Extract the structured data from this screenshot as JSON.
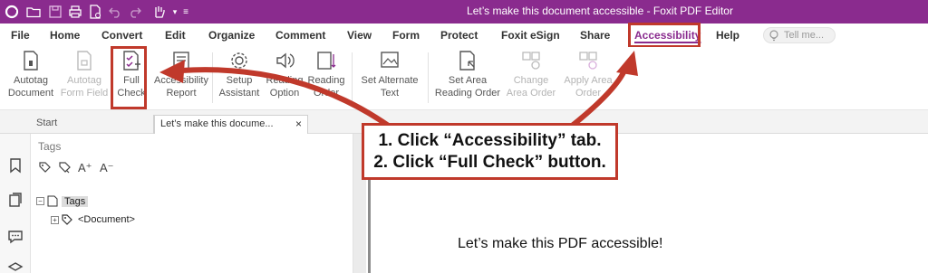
{
  "app": {
    "title": "Let’s make this document accessible - Foxit PDF Editor",
    "brand_color": "#8a2b8e",
    "callout_color": "#c0392b"
  },
  "quick_access": [
    "foxit-logo-icon",
    "open-icon",
    "save-icon",
    "print-icon",
    "new-doc-icon",
    "undo-icon",
    "redo-icon",
    "hand-tool-icon",
    "customize-icon"
  ],
  "menu": {
    "items": [
      "File",
      "Home",
      "Convert",
      "Edit",
      "Organize",
      "Comment",
      "View",
      "Form",
      "Protect",
      "Foxit eSign",
      "Share",
      "Accessibility",
      "Help"
    ],
    "active": "Accessibility",
    "tell_me_placeholder": "Tell me..."
  },
  "ribbon": {
    "autotag_document": [
      "Autotag",
      "Document"
    ],
    "autotag_form_field": [
      "Autotag",
      "Form Field"
    ],
    "full_check": [
      "Full",
      "Check"
    ],
    "accessibility_report": [
      "Accessibility",
      "Report"
    ],
    "setup_assistant": [
      "Setup",
      "Assistant"
    ],
    "reading_option": [
      "Reading",
      "Option"
    ],
    "reading_order": [
      "Reading",
      "Order"
    ],
    "set_alternate_text": [
      "Set Alternate",
      "Text"
    ],
    "set_area_reading_order": [
      "Set Area",
      "Reading Order"
    ],
    "change_area_order": [
      "Change",
      "Area Order"
    ],
    "apply_area_order": [
      "Apply Area",
      "Order"
    ]
  },
  "tabs": {
    "start": "Start",
    "document": "Let’s make this docume...",
    "close": "×"
  },
  "tags_panel": {
    "title": "Tags",
    "root": "Tags",
    "child": "<Document>"
  },
  "document": {
    "body_text": "Let’s make this PDF accessible!"
  },
  "callout": {
    "line1": "1. Click “Accessibility” tab.",
    "line2": "2. Click “Full Check” button."
  }
}
